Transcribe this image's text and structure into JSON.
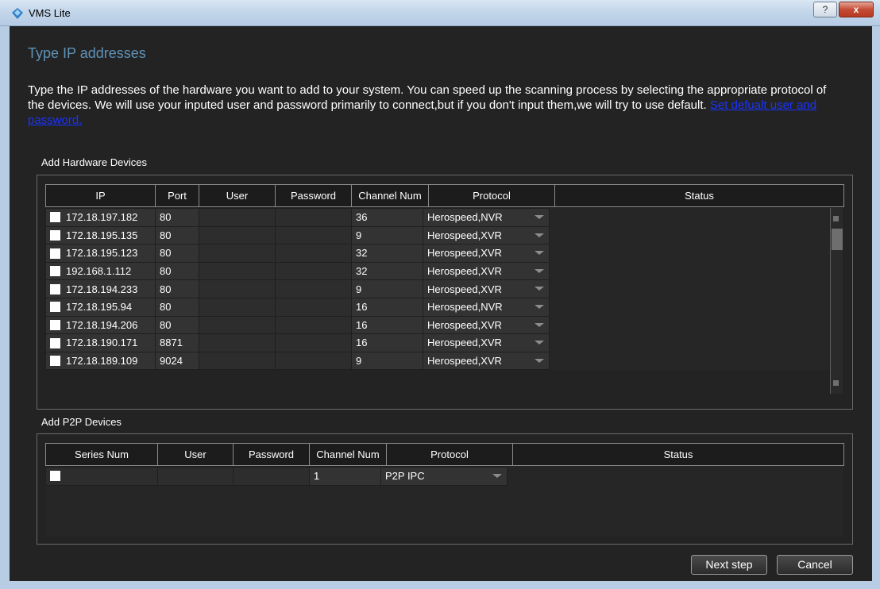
{
  "window": {
    "title": "VMS Lite",
    "help_glyph": "?",
    "close_glyph": "x"
  },
  "page": {
    "title": "Type IP addresses",
    "description": "Type the IP addresses of the hardware you want to add to your system. You can speed up the scanning process by selecting the appropriate protocol of the devices. We will use your inputed user and password primarily to connect,but if you don't input them,we will try to use default. ",
    "default_link": "Set defualt user and password."
  },
  "hardware": {
    "label": "Add Hardware Devices",
    "columns": [
      "IP",
      "Port",
      "User",
      "Password",
      "Channel Num",
      "Protocol",
      "Status"
    ],
    "rows": [
      {
        "ip": "172.18.197.182",
        "port": "80",
        "user": "",
        "password": "",
        "channel": "36",
        "protocol": "Herospeed,NVR",
        "status": ""
      },
      {
        "ip": "172.18.195.135",
        "port": "80",
        "user": "",
        "password": "",
        "channel": "9",
        "protocol": "Herospeed,XVR",
        "status": ""
      },
      {
        "ip": "172.18.195.123",
        "port": "80",
        "user": "",
        "password": "",
        "channel": "32",
        "protocol": "Herospeed,XVR",
        "status": ""
      },
      {
        "ip": "192.168.1.112",
        "port": "80",
        "user": "",
        "password": "",
        "channel": "32",
        "protocol": "Herospeed,XVR",
        "status": ""
      },
      {
        "ip": "172.18.194.233",
        "port": "80",
        "user": "",
        "password": "",
        "channel": "9",
        "protocol": "Herospeed,XVR",
        "status": ""
      },
      {
        "ip": "172.18.195.94",
        "port": "80",
        "user": "",
        "password": "",
        "channel": "16",
        "protocol": "Herospeed,NVR",
        "status": ""
      },
      {
        "ip": "172.18.194.206",
        "port": "80",
        "user": "",
        "password": "",
        "channel": "16",
        "protocol": "Herospeed,XVR",
        "status": ""
      },
      {
        "ip": "172.18.190.171",
        "port": "8871",
        "user": "",
        "password": "",
        "channel": "16",
        "protocol": "Herospeed,XVR",
        "status": ""
      },
      {
        "ip": "172.18.189.109",
        "port": "9024",
        "user": "",
        "password": "",
        "channel": "9",
        "protocol": "Herospeed,XVR",
        "status": ""
      }
    ]
  },
  "p2p": {
    "label": "Add P2P Devices",
    "columns": [
      "Series Num",
      "User",
      "Password",
      "Channel Num",
      "Protocol",
      "Status"
    ],
    "rows": [
      {
        "series": "",
        "user": "",
        "password": "",
        "channel": "1",
        "protocol": "P2P IPC",
        "status": ""
      }
    ]
  },
  "buttons": {
    "next": "Next step",
    "cancel": "Cancel"
  },
  "colors": {
    "title": "#5f93b8",
    "link": "#1a33ff",
    "background": "#232323"
  }
}
